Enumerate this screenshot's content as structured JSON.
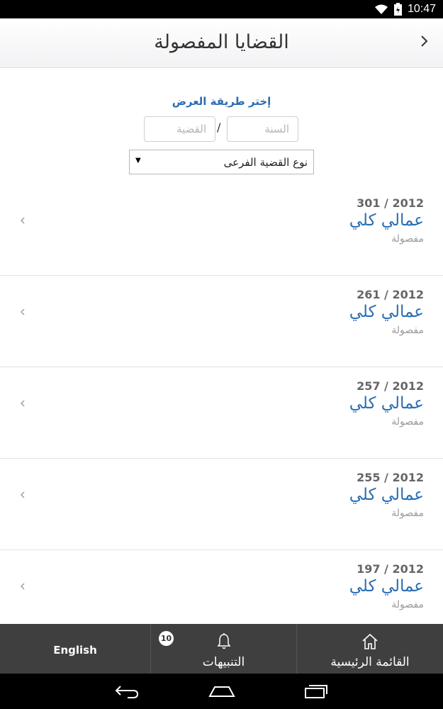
{
  "status_bar": {
    "time": "10:47"
  },
  "header": {
    "title": "القضايا المفصولة"
  },
  "filter": {
    "label": "إختر طريقة العرض",
    "year_placeholder": "السنة",
    "case_placeholder": "القضية",
    "separator": "/",
    "subtype_value": "نوع القضية الفرعى"
  },
  "cases": [
    {
      "number": "301 / 2012",
      "name": "عمالي كلي",
      "status": "مفصولة"
    },
    {
      "number": "261 / 2012",
      "name": "عمالي كلي",
      "status": "مفصولة"
    },
    {
      "number": "257 / 2012",
      "name": "عمالي كلي",
      "status": "مفصولة"
    },
    {
      "number": "255 / 2012",
      "name": "عمالي كلي",
      "status": "مفصولة"
    },
    {
      "number": "197 / 2012",
      "name": "عمالي كلي",
      "status": "مفصولة"
    }
  ],
  "tabs": {
    "english_label": "English",
    "alerts_label": "التنبيهات",
    "alerts_badge": "10",
    "home_label": "القائمة الرئيسية"
  },
  "colors": {
    "accent": "#2a6db3",
    "tab_bar": "#3f3f3f"
  }
}
